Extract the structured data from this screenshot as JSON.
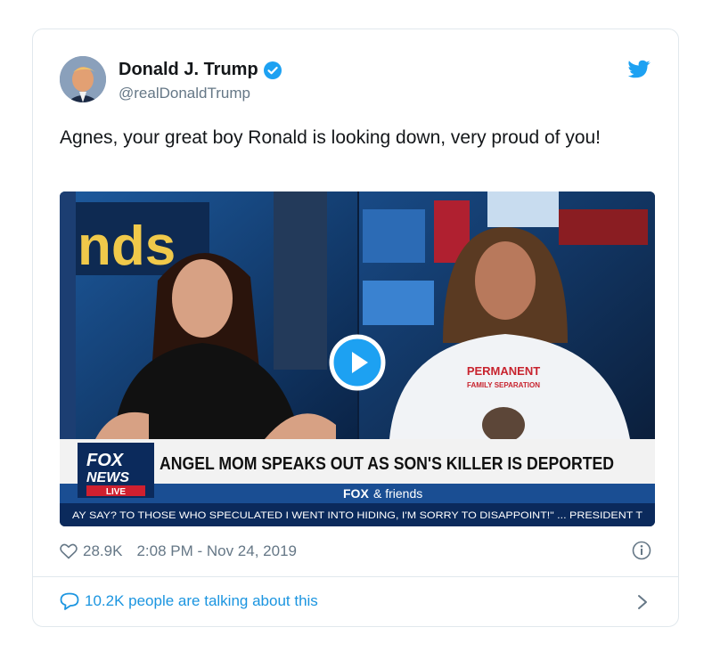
{
  "tweet": {
    "author_name": "Donald J. Trump",
    "handle": "@realDonaldTrump",
    "text": "Agnes, your great boy Ronald is looking down, very proud of you!",
    "likes": "28.9K",
    "timestamp": "2:08 PM - Nov 24, 2019",
    "talking": "10.2K people are talking about this"
  },
  "video": {
    "studio_sign": "nds",
    "shirt_line1": "PERMANENT",
    "shirt_line2": "FAMILY SEPARATION",
    "logo_line1": "FOX",
    "logo_line2": "NEWS",
    "logo_live": "LIVE",
    "headline": "ANGEL MOM SPEAKS OUT AS SON'S KILLER IS DEPORTED",
    "show_brand": "FOX",
    "show_name": "& friends",
    "ticker": "AY SAY? TO THOSE WHO SPECULATED I WENT INTO HIDING, I'M SORRY TO DISAPPOINT!\" ...   PRESIDENT T"
  },
  "icons": {
    "verified": "verified-badge-icon",
    "brand": "twitter-bird-icon",
    "like": "heart-icon",
    "info": "info-icon",
    "reply": "speech-bubble-icon",
    "more": "chevron-right-icon",
    "play": "play-icon"
  },
  "colors": {
    "twitter_blue": "#1da1f2",
    "link_blue": "#1b95e0",
    "secondary_text": "#657786",
    "fox_navy": "#0b2a5c",
    "fox_red": "#d0202f"
  }
}
